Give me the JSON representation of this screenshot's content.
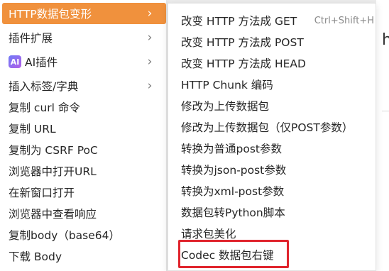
{
  "main_menu": {
    "items": [
      {
        "label": "HTTP数据包变形",
        "submenu": true,
        "active": true
      },
      {
        "label": "插件扩展",
        "submenu": true
      },
      {
        "label": "AI插件",
        "submenu": true,
        "icon": "ai-badge",
        "badge": "AI"
      },
      {
        "label": "插入标签/字典",
        "submenu": true
      },
      {
        "label": "复制 curl 命令"
      },
      {
        "label": "复制 URL"
      },
      {
        "label": "复制为 CSRF PoC"
      },
      {
        "label": "浏览器中打开URL"
      },
      {
        "label": "在新窗口打开"
      },
      {
        "label": "浏览器中查看响应"
      },
      {
        "label": "复制body（base64）"
      },
      {
        "label": "下载 Body"
      }
    ]
  },
  "submenu": {
    "items": [
      {
        "label": "改变 HTTP 方法成 GET",
        "shortcut": "Ctrl+Shift+H"
      },
      {
        "label": "改变 HTTP 方法成 POST"
      },
      {
        "label": "改变 HTTP 方法成 HEAD"
      },
      {
        "label": "HTTP Chunk 编码"
      },
      {
        "label": "修改为上传数据包"
      },
      {
        "label": "修改为上传数据包（仅POST参数）"
      },
      {
        "label": "转换为普通post参数"
      },
      {
        "label": "转换为json-post参数"
      },
      {
        "label": "转换为xml-post参数"
      },
      {
        "label": "数据包转Python脚本"
      },
      {
        "label": "请求包美化"
      },
      {
        "label": "Codec 数据包右键",
        "highlighted": true
      }
    ]
  },
  "background": {
    "glyph": "h"
  },
  "icons": {
    "chevron": "chevron-right-icon",
    "chevron_glyph": "›"
  },
  "colors": {
    "active_bg": "#f0913d",
    "highlight_border": "#e0242d"
  }
}
